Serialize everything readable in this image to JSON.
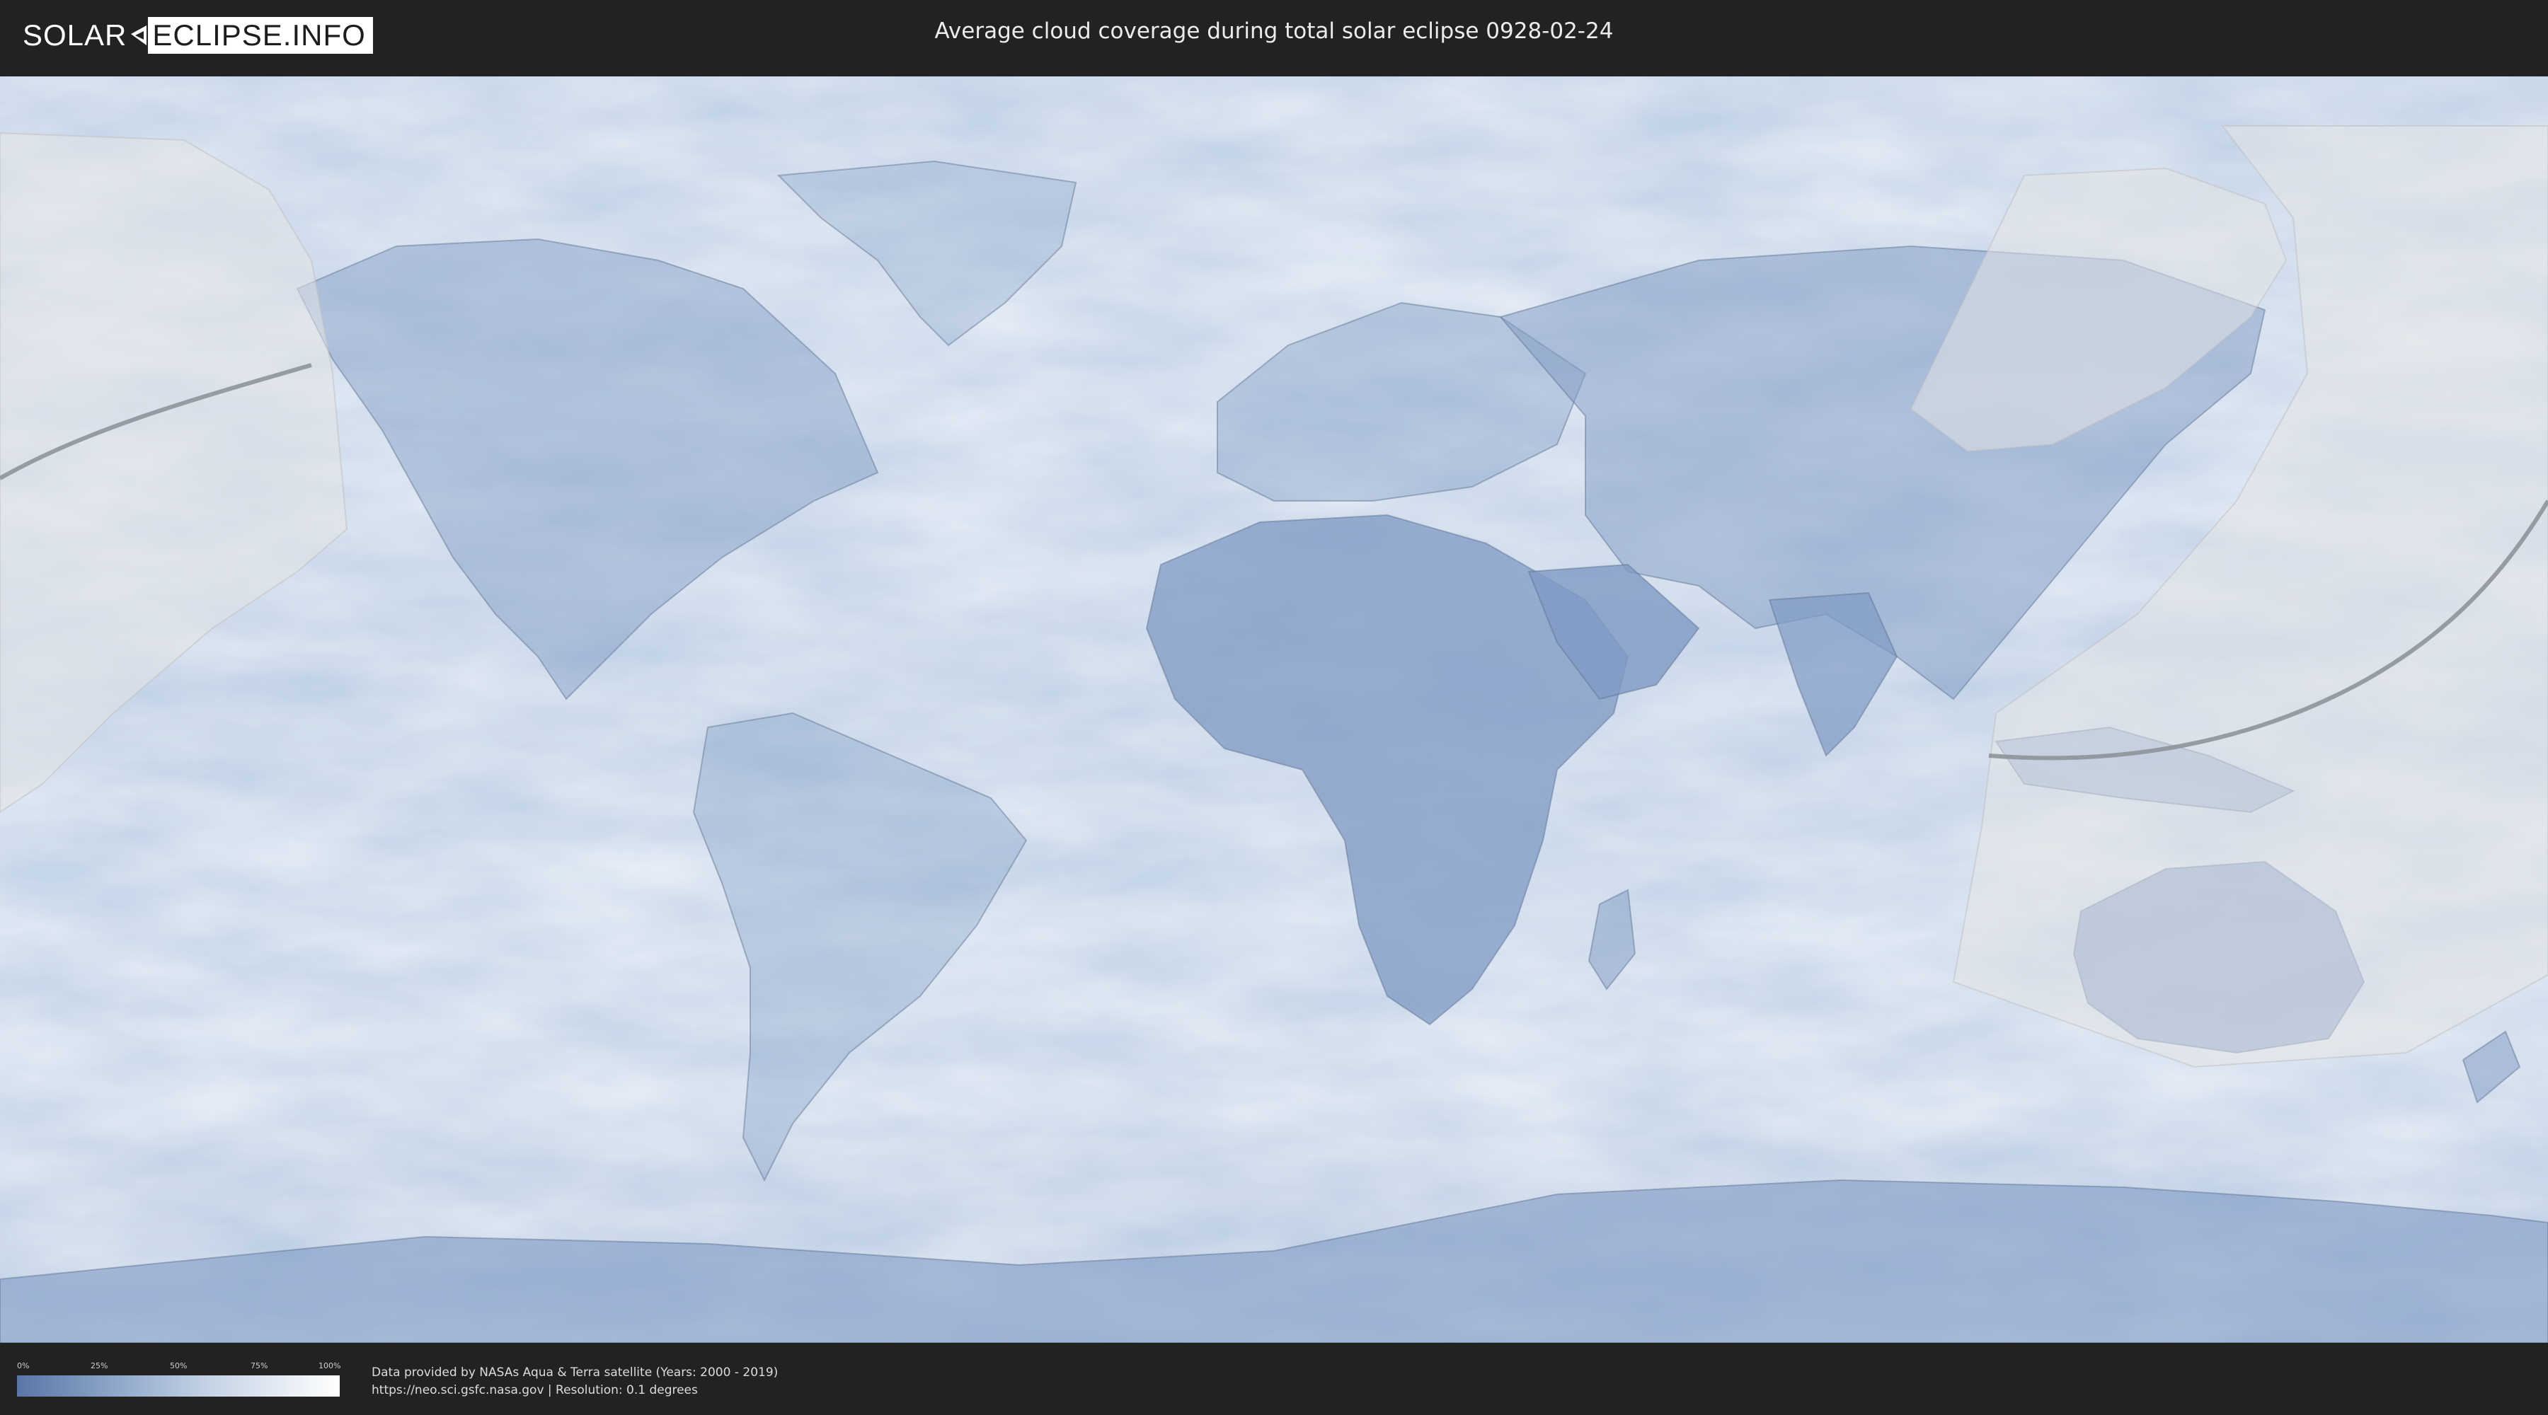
{
  "header": {
    "logo_left": "SOLAR",
    "logo_right": "ECLIPSE.INFO",
    "title": "Average cloud coverage during total solar eclipse 0928-02-24"
  },
  "legend": {
    "ticks": [
      "0%",
      "25%",
      "50%",
      "75%",
      "100%"
    ],
    "color_low": "#5a76a6",
    "color_high": "#ffffff"
  },
  "credits": {
    "line1": "Data provided by NASAs Aqua & Terra satellite (Years: 2000 - 2019)",
    "line2": "https://neo.sci.gsfc.nasa.gov | Resolution: 0.1 degrees"
  },
  "colors": {
    "background": "#222222",
    "ocean_cloud": "#dde7f3",
    "land_clear": "#6f8bb8",
    "path_line": "#8a8f96"
  }
}
